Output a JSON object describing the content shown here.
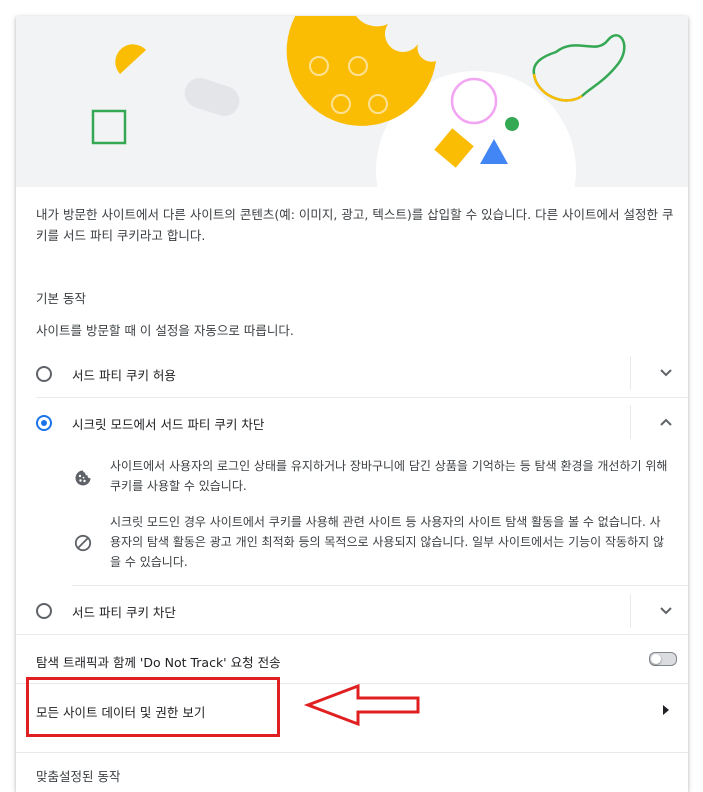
{
  "description": "내가 방문한 사이트에서 다른 사이트의 콘텐츠(예: 이미지, 광고, 텍스트)를 삽입할 수 있습니다. 다른 사이트에서 설정한 쿠키를 서드 파티 쿠키라고 합니다.",
  "default_behavior": {
    "title": "기본 동작",
    "subtitle": "사이트를 방문할 때 이 설정을 자동으로 따릅니다.",
    "options": [
      {
        "label": "서드 파티 쿠키 허용",
        "selected": false,
        "expanded": false
      },
      {
        "label": "시크릿 모드에서 서드 파티 쿠키 차단",
        "selected": true,
        "expanded": true,
        "details": [
          {
            "icon": "cookie-icon",
            "text": "사이트에서 사용자의 로그인 상태를 유지하거나 장바구니에 담긴 상품을 기억하는 등 탐색 환경을 개선하기 위해 쿠키를 사용할 수 있습니다."
          },
          {
            "icon": "block-icon",
            "text": "시크릿 모드인 경우 사이트에서 쿠키를 사용해 관련 사이트 등 사용자의 사이트 탐색 활동을 볼 수 없습니다. 사용자의 탐색 활동은 광고 개인 최적화 등의 목적으로 사용되지 않습니다. 일부 사이트에서는 기능이 작동하지 않을 수 있습니다."
          }
        ]
      },
      {
        "label": "서드 파티 쿠키 차단",
        "selected": false,
        "expanded": false
      }
    ]
  },
  "do_not_track": {
    "label": "탐색 트래픽과 함께 'Do Not Track' 요청 전송",
    "enabled": false
  },
  "all_site_data": {
    "label": "모든 사이트 데이터 및 권한 보기"
  },
  "custom_behavior": {
    "title": "맞춤설정된 동작"
  },
  "colors": {
    "accent": "#1a73e8",
    "annotation": "#e02020",
    "cookie": "#fbbc04"
  }
}
